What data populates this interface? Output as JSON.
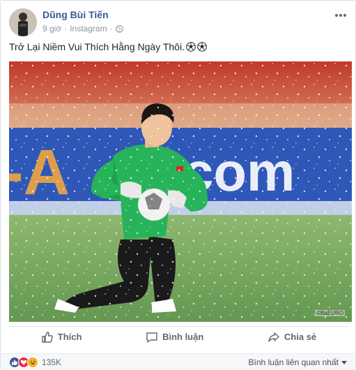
{
  "post": {
    "author": "Dũng Bùi Tiến",
    "time": "9 giờ",
    "separator": "·",
    "source": "Instagram",
    "more_icon": "more-options-icon",
    "privacy_icon": "globe-icon",
    "text": "Trở Lại Niềm Vui Thích Hằng Ngày Thôi.",
    "emojis": [
      "soccer-ball",
      "soccer-ball"
    ]
  },
  "photo": {
    "watermark": "©BaEURO",
    "alt_subject": "goalkeeper kneeling with ball in snow"
  },
  "actions": {
    "like_label": "Thích",
    "comment_label": "Bình luận",
    "share_label": "Chia sẻ"
  },
  "footer": {
    "reaction_count": "135K",
    "reactions": [
      "like",
      "love",
      "haha"
    ],
    "sort_label": "Bình luận liên quan nhất"
  },
  "colors": {
    "link_blue": "#365899",
    "like_blue": "#3b5998",
    "love_red": "#f0284a",
    "haha_yellow": "#f7b125",
    "goalkeeper_green": "#2eb85c"
  }
}
